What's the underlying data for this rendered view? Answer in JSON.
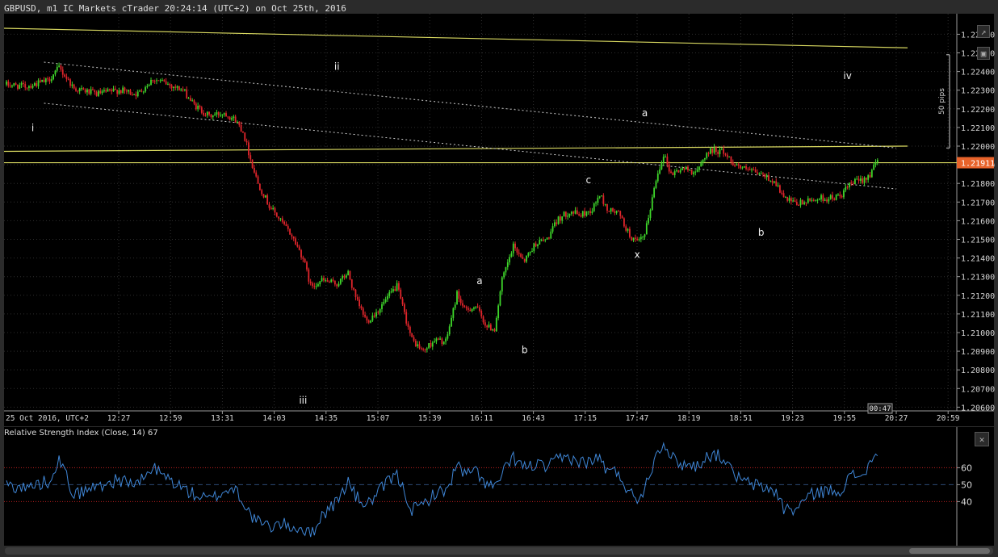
{
  "window": {
    "title": "GBPUSD, m1 IC Markets cTrader 20:24:14 (UTC+2) on Oct 25th, 2016"
  },
  "colors": {
    "background": "#000000",
    "grid": "#2e2e2e",
    "bull": "#3ed62a",
    "bear": "#e0252b",
    "trendline": "#d8d860",
    "channel": "#cccccc",
    "price_label": "#e8632a",
    "rsi_line": "#3f86d6",
    "rsi_level": "#c02020"
  },
  "icons": {
    "tool_1": "expand-icon",
    "tool_2": "camera-icon",
    "rsi_close": "close-icon"
  },
  "chart_data": [
    {
      "type": "candlestick",
      "symbol": "GBPUSD",
      "timeframe": "m1",
      "x_tick_labels": [
        "25 Oct 2016, UTC+2",
        "12:27",
        "12:59",
        "13:31",
        "14:03",
        "14:35",
        "15:07",
        "15:39",
        "16:11",
        "16:43",
        "17:15",
        "17:47",
        "18:19",
        "18:51",
        "19:23",
        "19:55",
        "20:27",
        "20:59"
      ],
      "y_tick_labels": [
        "1.22600",
        "1.22500",
        "1.22400",
        "1.22300",
        "1.22200",
        "1.22100",
        "1.22000",
        "1.21900",
        "1.21800",
        "1.21700",
        "1.21600",
        "1.21500",
        "1.21400",
        "1.21300",
        "1.21200",
        "1.21100",
        "1.21000",
        "1.20900",
        "1.20800",
        "1.20700",
        "1.20600"
      ],
      "ylim": [
        1.2058,
        1.2271
      ],
      "current_price": "1.21911",
      "time_label": "00:47",
      "pips_label": "50 pips",
      "path_points": [
        [
          0,
          1.2233
        ],
        [
          10,
          1.2232
        ],
        [
          22,
          1.2235
        ],
        [
          28,
          1.2242
        ],
        [
          36,
          1.2231
        ],
        [
          48,
          1.2228
        ],
        [
          60,
          1.223
        ],
        [
          70,
          1.2228
        ],
        [
          78,
          1.2236
        ],
        [
          84,
          1.2234
        ],
        [
          94,
          1.223
        ],
        [
          100,
          1.2222
        ],
        [
          108,
          1.2216
        ],
        [
          116,
          1.2218
        ],
        [
          122,
          1.2214
        ],
        [
          126,
          1.2208
        ],
        [
          130,
          1.2193
        ],
        [
          134,
          1.218
        ],
        [
          140,
          1.2168
        ],
        [
          146,
          1.216
        ],
        [
          152,
          1.2152
        ],
        [
          158,
          1.214
        ],
        [
          162,
          1.2125
        ],
        [
          168,
          1.2128
        ],
        [
          176,
          1.2126
        ],
        [
          182,
          1.2132
        ],
        [
          186,
          1.2118
        ],
        [
          192,
          1.2106
        ],
        [
          198,
          1.2112
        ],
        [
          204,
          1.212
        ],
        [
          208,
          1.2125
        ],
        [
          212,
          1.211
        ],
        [
          216,
          1.2096
        ],
        [
          222,
          1.209
        ],
        [
          228,
          1.2096
        ],
        [
          234,
          1.2095
        ],
        [
          238,
          1.2112
        ],
        [
          240,
          1.2121
        ],
        [
          244,
          1.2112
        ],
        [
          250,
          1.2114
        ],
        [
          256,
          1.2103
        ],
        [
          260,
          1.2102
        ],
        [
          264,
          1.2128
        ],
        [
          270,
          1.2146
        ],
        [
          276,
          1.2139
        ],
        [
          282,
          1.2148
        ],
        [
          288,
          1.215
        ],
        [
          294,
          1.2161
        ],
        [
          300,
          1.2165
        ],
        [
          306,
          1.2163
        ],
        [
          312,
          1.2166
        ],
        [
          316,
          1.2174
        ],
        [
          320,
          1.2166
        ],
        [
          326,
          1.2164
        ],
        [
          332,
          1.2152
        ],
        [
          336,
          1.2148
        ],
        [
          340,
          1.2152
        ],
        [
          346,
          1.2182
        ],
        [
          350,
          1.2196
        ],
        [
          354,
          1.2185
        ],
        [
          360,
          1.2188
        ],
        [
          368,
          1.2186
        ],
        [
          372,
          1.2195
        ],
        [
          376,
          1.2198
        ],
        [
          382,
          1.2197
        ],
        [
          386,
          1.2192
        ],
        [
          392,
          1.2188
        ],
        [
          398,
          1.2186
        ],
        [
          404,
          1.2184
        ],
        [
          410,
          1.218
        ],
        [
          414,
          1.2172
        ],
        [
          420,
          1.2169
        ],
        [
          426,
          1.217
        ],
        [
          432,
          1.2172
        ],
        [
          438,
          1.2172
        ],
        [
          444,
          1.2173
        ],
        [
          450,
          1.218
        ],
        [
          456,
          1.2182
        ],
        [
          460,
          1.2185
        ],
        [
          464,
          1.2192
        ]
      ],
      "lines": [
        {
          "kind": "horizontal",
          "price": 1.21911
        },
        {
          "kind": "trend",
          "from": [
            0,
            1.22632
          ],
          "to": [
            480,
            1.22527
          ]
        },
        {
          "kind": "trend",
          "from": [
            0,
            1.21972
          ],
          "to": [
            480,
            1.22
          ]
        },
        {
          "kind": "dotted",
          "from": [
            20,
            1.2245
          ],
          "to": [
            474,
            1.2199
          ]
        },
        {
          "kind": "dotted",
          "from": [
            20,
            1.2223
          ],
          "to": [
            474,
            1.2177
          ]
        }
      ],
      "annotations": [
        {
          "text": "i",
          "bar": 14,
          "price": 1.2208
        },
        {
          "text": "ii",
          "bar": 176,
          "price": 1.2241
        },
        {
          "text": "iii",
          "bar": 158,
          "price": 1.2062
        },
        {
          "text": "iv",
          "bar": 448,
          "price": 1.2236
        },
        {
          "text": "a",
          "bar": 252,
          "price": 1.2126
        },
        {
          "text": "b",
          "bar": 276,
          "price": 1.2089
        },
        {
          "text": "c",
          "bar": 310,
          "price": 1.218
        },
        {
          "text": "x",
          "bar": 336,
          "price": 1.214
        },
        {
          "text": "a",
          "bar": 340,
          "price": 1.2216
        },
        {
          "text": "b",
          "bar": 402,
          "price": 1.2152
        }
      ]
    },
    {
      "type": "line",
      "title": "Relative Strength Index (Close, 14) 67",
      "y_tick_labels": [
        "60",
        "50",
        "40"
      ],
      "levels": [
        60,
        50,
        40
      ],
      "ylim": [
        14,
        84
      ],
      "final_value": 67,
      "path_points": [
        [
          0,
          50
        ],
        [
          10,
          48
        ],
        [
          22,
          52
        ],
        [
          28,
          65
        ],
        [
          36,
          44
        ],
        [
          48,
          49
        ],
        [
          60,
          53
        ],
        [
          70,
          50
        ],
        [
          78,
          60
        ],
        [
          84,
          55
        ],
        [
          94,
          48
        ],
        [
          100,
          44
        ],
        [
          108,
          41
        ],
        [
          116,
          46
        ],
        [
          122,
          48
        ],
        [
          126,
          40
        ],
        [
          130,
          32
        ],
        [
          134,
          28
        ],
        [
          140,
          25
        ],
        [
          146,
          27
        ],
        [
          152,
          25
        ],
        [
          158,
          24
        ],
        [
          162,
          20
        ],
        [
          168,
          32
        ],
        [
          176,
          40
        ],
        [
          182,
          52
        ],
        [
          186,
          43
        ],
        [
          192,
          38
        ],
        [
          198,
          45
        ],
        [
          204,
          53
        ],
        [
          208,
          55
        ],
        [
          212,
          46
        ],
        [
          216,
          35
        ],
        [
          222,
          38
        ],
        [
          228,
          45
        ],
        [
          234,
          46
        ],
        [
          238,
          56
        ],
        [
          240,
          62
        ],
        [
          244,
          56
        ],
        [
          250,
          58
        ],
        [
          256,
          50
        ],
        [
          260,
          48
        ],
        [
          264,
          56
        ],
        [
          270,
          66
        ],
        [
          276,
          60
        ],
        [
          282,
          62
        ],
        [
          288,
          60
        ],
        [
          294,
          65
        ],
        [
          300,
          66
        ],
        [
          306,
          63
        ],
        [
          312,
          64
        ],
        [
          316,
          66
        ],
        [
          320,
          58
        ],
        [
          326,
          57
        ],
        [
          332,
          45
        ],
        [
          336,
          42
        ],
        [
          340,
          48
        ],
        [
          346,
          68
        ],
        [
          350,
          76
        ],
        [
          354,
          66
        ],
        [
          360,
          62
        ],
        [
          368,
          61
        ],
        [
          372,
          66
        ],
        [
          376,
          68
        ],
        [
          382,
          66
        ],
        [
          386,
          58
        ],
        [
          392,
          52
        ],
        [
          398,
          50
        ],
        [
          404,
          48
        ],
        [
          410,
          46
        ],
        [
          414,
          36
        ],
        [
          420,
          35
        ],
        [
          426,
          42
        ],
        [
          432,
          46
        ],
        [
          438,
          46
        ],
        [
          444,
          47
        ],
        [
          450,
          55
        ],
        [
          456,
          56
        ],
        [
          460,
          62
        ],
        [
          464,
          67
        ]
      ]
    }
  ]
}
